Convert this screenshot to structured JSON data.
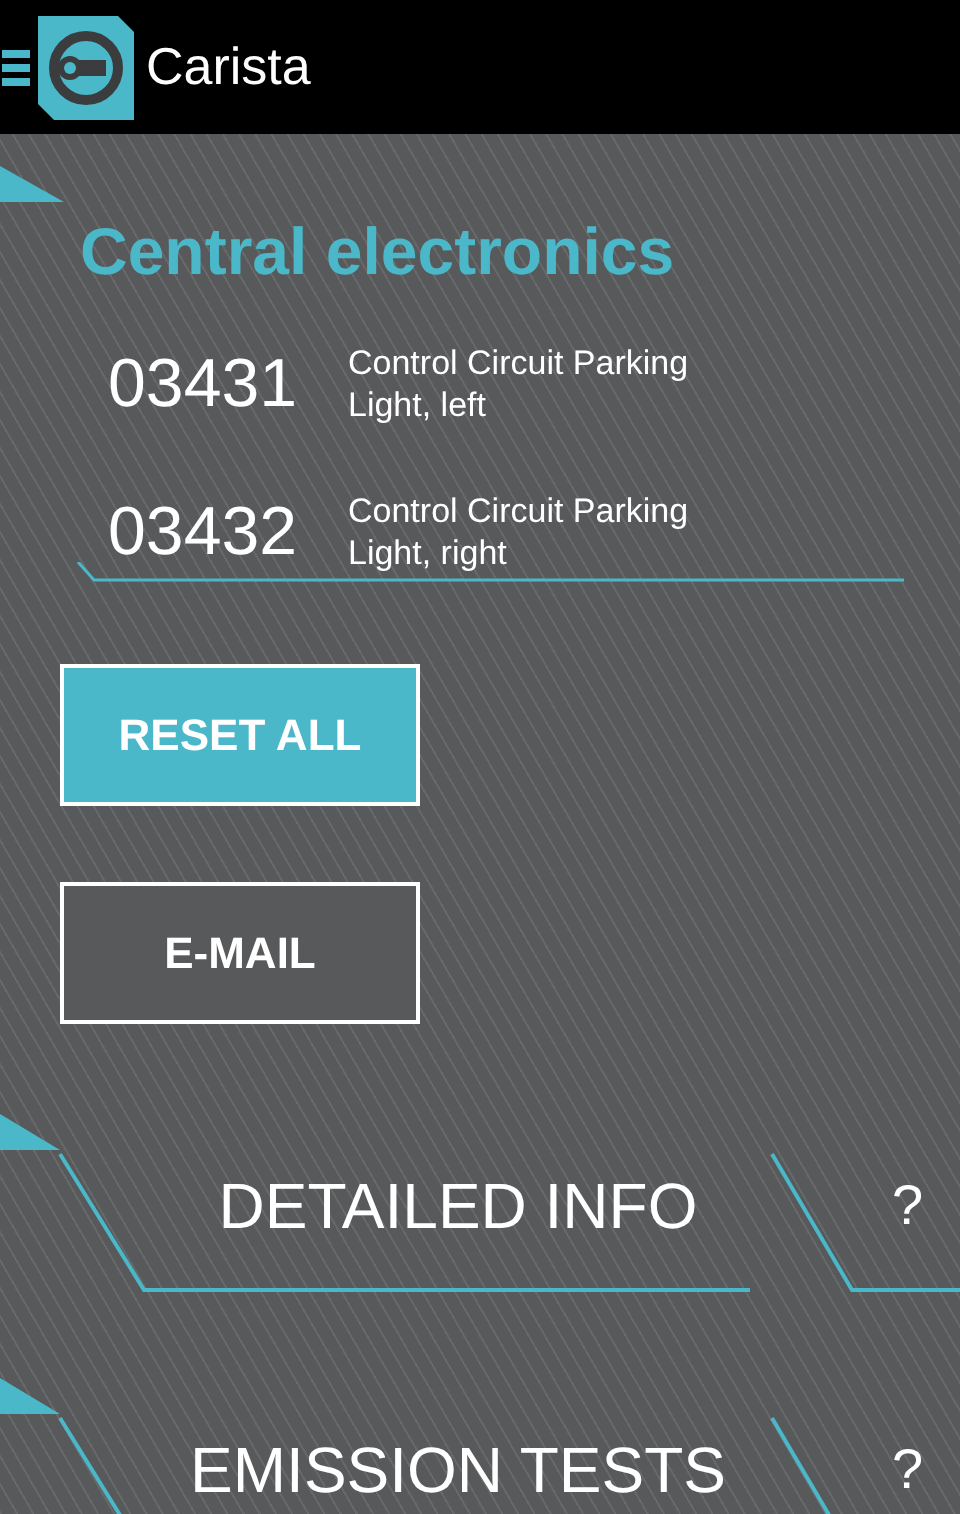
{
  "app": {
    "title": "Carista"
  },
  "section": {
    "title": "Central electronics",
    "faults": [
      {
        "code": "03431",
        "description": "Control Circuit Parking Light, left"
      },
      {
        "code": "03432",
        "description": "Control Circuit Parking Light, right"
      }
    ]
  },
  "buttons": [
    {
      "label": "RESET ALL",
      "kind": "primary"
    },
    {
      "label": "E-MAIL",
      "kind": "outline"
    }
  ],
  "menu": [
    {
      "label": "DETAILED INFO",
      "help": "?"
    },
    {
      "label": "EMISSION TESTS",
      "help": "?"
    }
  ]
}
